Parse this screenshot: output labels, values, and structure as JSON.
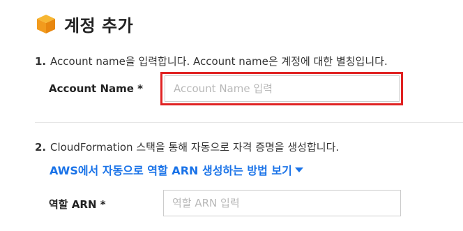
{
  "header": {
    "title": "계정 추가",
    "icon": "aws-cube-icon",
    "icon_color": "#f5a623"
  },
  "step1": {
    "number": "1.",
    "text": "Account name을 입력합니다. Account name은 계정에 대한 별칭입니다.",
    "field_label": "Account Name *",
    "input_placeholder": "Account Name 입력",
    "input_value": "",
    "highlight_color": "#e02222"
  },
  "step2": {
    "number": "2.",
    "text": "CloudFormation 스택을 통해 자동으로 자격 증명을 생성합니다.",
    "help_link": "AWS에서 자동으로 역할 ARN 생성하는 방법 보기",
    "link_color": "#1a73e8",
    "field_label": "역할 ARN *",
    "input_placeholder": "역할 ARN 입력",
    "input_value": ""
  }
}
